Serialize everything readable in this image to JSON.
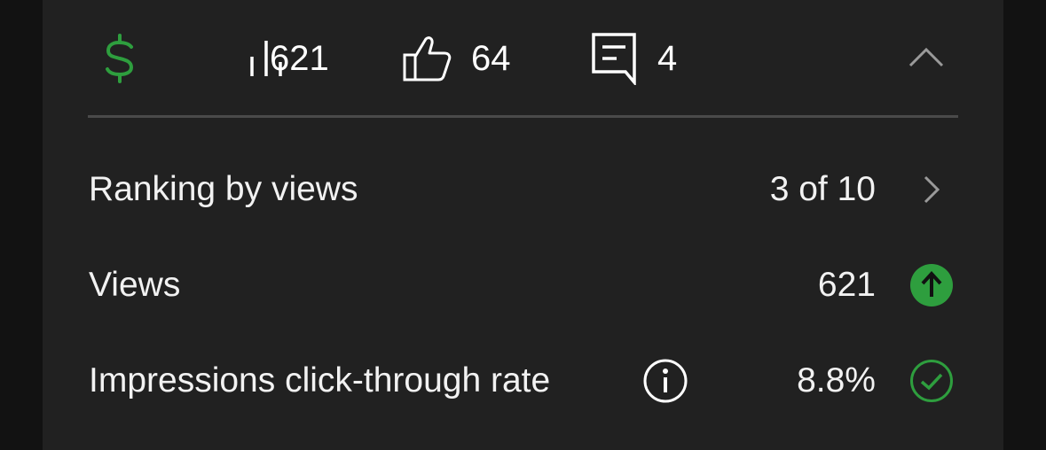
{
  "accent_green": "#2e9e3e",
  "stats": {
    "revenue_icon": "dollar-icon",
    "views_icon": "bar-chart-icon",
    "views_count": "621",
    "likes_icon": "thumbs-up-icon",
    "likes_count": "64",
    "comments_icon": "comment-icon",
    "comments_count": "4",
    "collapse_icon": "chevron-up-icon"
  },
  "metrics": [
    {
      "label": "Ranking by views",
      "value": "3 of 10",
      "trailing_icon": "chevron-right-icon"
    },
    {
      "label": "Views",
      "value": "621",
      "trailing_icon": "arrow-up-circle-icon"
    },
    {
      "label": "Impressions click-through rate",
      "value": "8.8%",
      "info_icon": "info-icon",
      "trailing_icon": "check-circle-icon"
    }
  ]
}
